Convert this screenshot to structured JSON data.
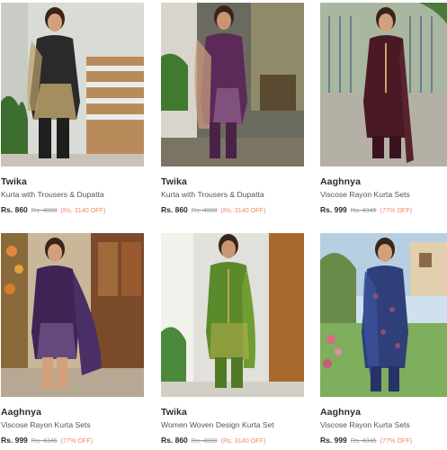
{
  "products": [
    {
      "brand": "Twika",
      "name": "Kurta with Trousers & Dupatta",
      "price": "Rs. 860",
      "mrp": "Rs. 4000",
      "discount": "(Rs. 3140 OFF)",
      "image": "woman-black-kurta-dupatta-photo",
      "colors": {
        "bg": "#d9dcd6",
        "garment": "#2a2a2a",
        "accent": "#b8a06a"
      }
    },
    {
      "brand": "Twika",
      "name": "Kurta with Trousers & Dupatta",
      "price": "Rs. 860",
      "mrp": "Rs. 4000",
      "discount": "(Rs. 3140 OFF)",
      "image": "woman-purple-kurta-dupatta-photo",
      "colors": {
        "bg": "#6b6a5e",
        "garment": "#5b2a58",
        "accent": "#c79a7d"
      }
    },
    {
      "brand": "Aaghnya",
      "name": "Viscose Rayon Kurta Sets",
      "price": "Rs. 999",
      "mrp": "Rs. 4345",
      "discount": "(77% OFF)",
      "image": "woman-maroon-kurta-photo",
      "colors": {
        "bg": "#b9c3b0",
        "garment": "#4a1a24",
        "accent": "#c9a46a"
      }
    },
    {
      "brand": "Aaghnya",
      "name": "Viscose Rayon Kurta Sets",
      "price": "Rs. 999",
      "mrp": "Rs. 4345",
      "discount": "(77% OFF)",
      "image": "woman-violet-kurta-photo",
      "colors": {
        "bg": "#c9b79a",
        "garment": "#3e2556",
        "accent": "#b08bc2"
      }
    },
    {
      "brand": "Twika",
      "name": "Women Woven Design Kurta Set",
      "price": "Rs. 860",
      "mrp": "Rs. 4000",
      "discount": "(Rs. 3140 OFF)",
      "image": "woman-green-kurta-set-photo",
      "colors": {
        "bg": "#e2e0da",
        "garment": "#5a8a2a",
        "accent": "#d6b85a"
      }
    },
    {
      "brand": "Aaghnya",
      "name": "Viscose Rayon Kurta Sets",
      "price": "Rs. 999",
      "mrp": "Rs. 4345",
      "discount": "(77% OFF)",
      "image": "woman-blue-printed-kurta-photo",
      "colors": {
        "bg": "#7fae5c",
        "garment": "#2e3f7a",
        "accent": "#c55b6a"
      }
    }
  ]
}
